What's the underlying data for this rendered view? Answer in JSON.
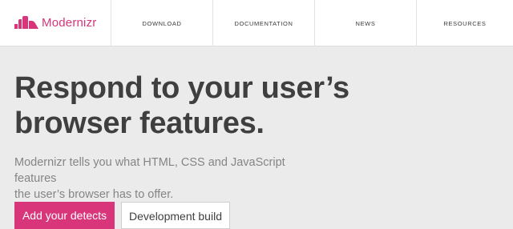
{
  "brand": {
    "name": "Modernizr",
    "logo_icon": "modernizr-logo-icon",
    "accent_color": "#d8357a"
  },
  "nav": {
    "items": [
      {
        "label": "DOWNLOAD"
      },
      {
        "label": "DOCUMENTATION"
      },
      {
        "label": "NEWS"
      },
      {
        "label": "RESOURCES"
      }
    ]
  },
  "hero": {
    "headline_line1": "Respond to your user’s",
    "headline_line2": "browser features.",
    "subtext_line1": "Modernizr tells you what HTML, CSS and JavaScript features",
    "subtext_line2": "the user’s browser has to offer.",
    "primary_button": "Add your detects",
    "secondary_button": "Development build"
  }
}
